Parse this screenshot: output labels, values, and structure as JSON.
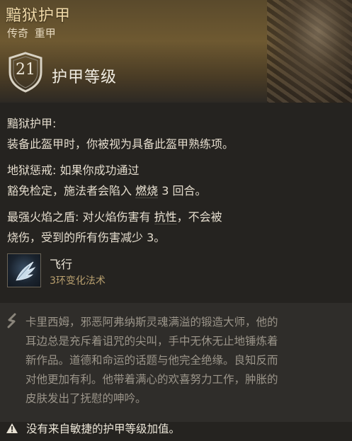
{
  "item": {
    "name": "黯狱护甲",
    "rarity": "传奇",
    "type": "重甲",
    "armor_class": "21",
    "armor_class_label": "护甲等级"
  },
  "properties": [
    {
      "title": "黯狱护甲:",
      "text": "装备此盔甲时，你被视为具备此盔甲熟练项。"
    },
    {
      "title": "地狱惩戒:",
      "text1": "如果你成功通过",
      "line2a": "豁免检定，施法者会陷入",
      "keyword": "燃烧",
      "line2b": "3 回合。"
    },
    {
      "title": "最强火焰之盾:",
      "text1": "对火焰伤害有",
      "keyword": "抗性",
      "text1b": "，不会被",
      "line2": "烧伤，受到的所有伤害减少 3。"
    }
  ],
  "spell": {
    "name": "飞行",
    "meta": "3环变化法术",
    "icon": "wing-icon"
  },
  "lore": [
    "卡里西姆，邪恶阿弗纳斯灵魂满溢的锻造大师，他的",
    "耳边总是充斥着诅咒的尖叫，手中无休无止地锤炼着",
    "新作品。道德和命运的话题与他完全绝缘。良知反而",
    "对他更加有利。他带着满心的欢喜努力工作，肿胀的",
    "皮肤发出了抚慰的呻吟。"
  ],
  "warning": "没有来自敏捷的护甲等级加值。",
  "colors": {
    "header": "#6e5931",
    "title": "#f0d9a8",
    "lore_text": "#9b958a",
    "spell_meta": "#b89f6e"
  }
}
